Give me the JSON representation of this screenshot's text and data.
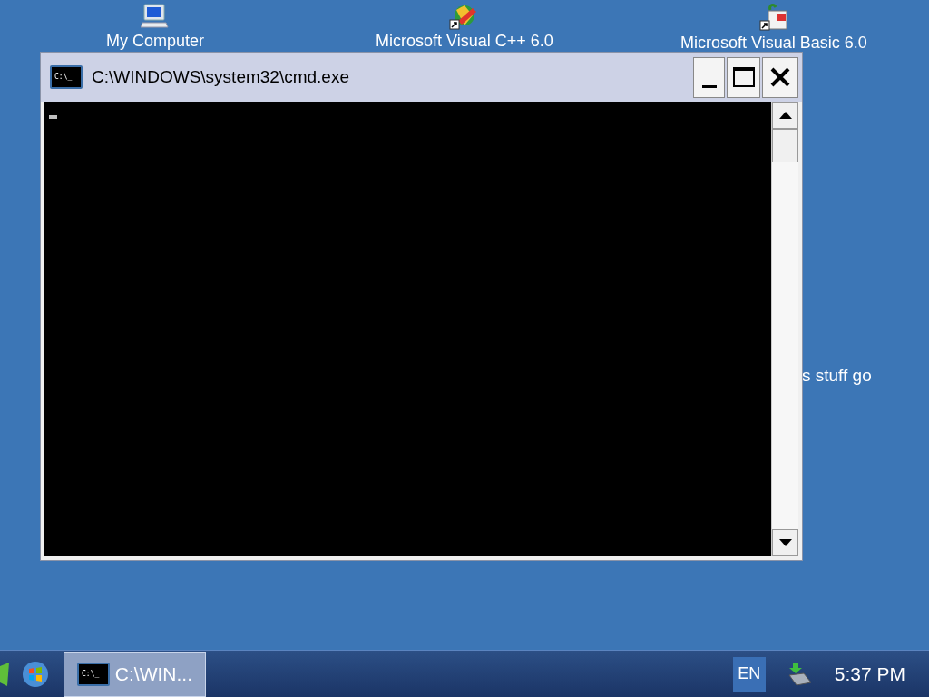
{
  "desktop_icons": [
    {
      "label": "My Computer",
      "kind": "computer"
    },
    {
      "label": "Microsoft Visual C++ 6.0",
      "kind": "vcpp"
    },
    {
      "label": "Microsoft Visual Basic 6.0",
      "kind": "vb"
    }
  ],
  "desktop_partial_label": "s stuff go",
  "window": {
    "title": "C:\\WINDOWS\\system32\\cmd.exe",
    "icon_text": "C:\\_"
  },
  "taskbar": {
    "buttons": [
      {
        "label": "C:\\WIN...",
        "icon_text": "C:\\_",
        "selected": true
      }
    ],
    "language": "EN",
    "clock": "5:37 PM"
  }
}
